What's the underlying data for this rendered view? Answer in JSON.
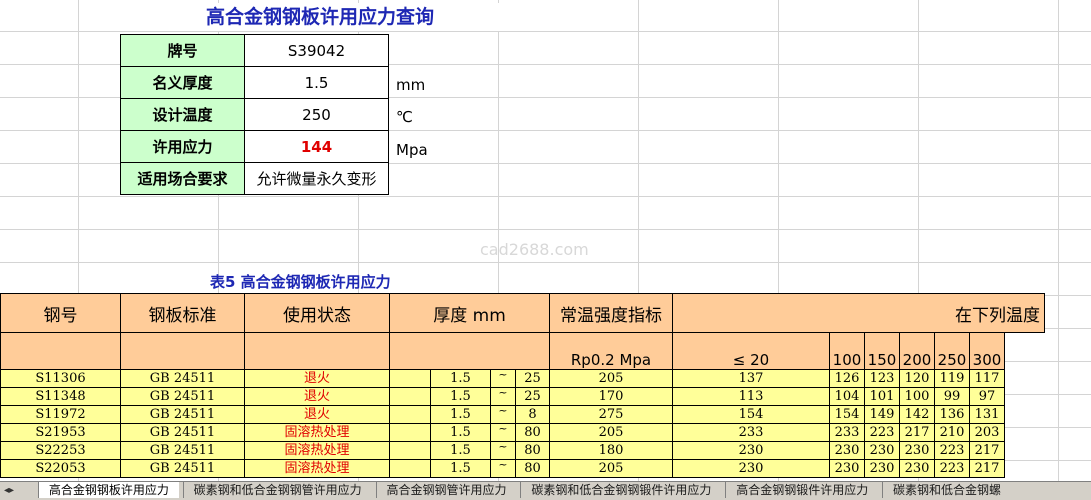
{
  "title": "高合金钢钢板许用应力查询",
  "query": {
    "rows": [
      {
        "label": "牌号",
        "value": "S39042",
        "unit": ""
      },
      {
        "label": "名义厚度",
        "value": "1.5",
        "unit": "mm"
      },
      {
        "label": "设计温度",
        "value": "250",
        "unit": "℃"
      },
      {
        "label": "许用应力",
        "value": "144",
        "unit": "Mpa"
      },
      {
        "label": "适用场合要求",
        "value": "允许微量永久变形",
        "unit": ""
      }
    ]
  },
  "watermark": "cad2688.com",
  "table": {
    "title": "表5 高合金钢钢板许用应力",
    "header1": {
      "grade": "钢号",
      "standard": "钢板标准",
      "condition": "使用状态",
      "thickness": "厚度 mm",
      "strength": "常温强度指标",
      "temps": "在下列温度"
    },
    "header2": {
      "rp": "Rp0.2 Mpa",
      "t20": "≤ 20",
      "t100": "100",
      "t150": "150",
      "t200": "200",
      "t250": "250",
      "t300": "300"
    },
    "rows": [
      {
        "grade": "S11306",
        "std": "GB 24511",
        "cond": "退火",
        "tmin": "1.5",
        "tilde": "~",
        "tmax": "25",
        "rp": "205",
        "s20": "137",
        "s100": "126",
        "s150": "123",
        "s200": "120",
        "s250": "119",
        "s300": "117"
      },
      {
        "grade": "S11348",
        "std": "GB 24511",
        "cond": "退火",
        "tmin": "1.5",
        "tilde": "~",
        "tmax": "25",
        "rp": "170",
        "s20": "113",
        "s100": "104",
        "s150": "101",
        "s200": "100",
        "s250": "99",
        "s300": "97"
      },
      {
        "grade": "S11972",
        "std": "GB 24511",
        "cond": "退火",
        "tmin": "1.5",
        "tilde": "~",
        "tmax": "8",
        "rp": "275",
        "s20": "154",
        "s100": "154",
        "s150": "149",
        "s200": "142",
        "s250": "136",
        "s300": "131"
      },
      {
        "grade": "S21953",
        "std": "GB 24511",
        "cond": "固溶热处理",
        "tmin": "1.5",
        "tilde": "~",
        "tmax": "80",
        "rp": "205",
        "s20": "233",
        "s100": "233",
        "s150": "223",
        "s200": "217",
        "s250": "210",
        "s300": "203"
      },
      {
        "grade": "S22253",
        "std": "GB 24511",
        "cond": "固溶热处理",
        "tmin": "1.5",
        "tilde": "~",
        "tmax": "80",
        "rp": "180",
        "s20": "230",
        "s100": "230",
        "s150": "230",
        "s200": "230",
        "s250": "223",
        "s300": "217"
      },
      {
        "grade": "S22053",
        "std": "GB 24511",
        "cond": "固溶热处理",
        "tmin": "1.5",
        "tilde": "~",
        "tmax": "80",
        "rp": "205",
        "s20": "230",
        "s100": "230",
        "s150": "230",
        "s200": "230",
        "s250": "223",
        "s300": "217"
      }
    ]
  },
  "tabs": [
    "高合金钢钢板许用应力",
    "碳素钢和低合金钢钢管许用应力",
    "高合金钢钢管许用应力",
    "碳素钢和低合金钢钢锻件许用应力",
    "高合金钢钢锻件许用应力",
    "碳素钢和低合金钢螺"
  ],
  "colors": {
    "title": "#1e28b4",
    "label_bg": "#ccffcc",
    "header_bg": "#ffcc99",
    "row_bg": "#ffff99",
    "result": "#e00000"
  }
}
